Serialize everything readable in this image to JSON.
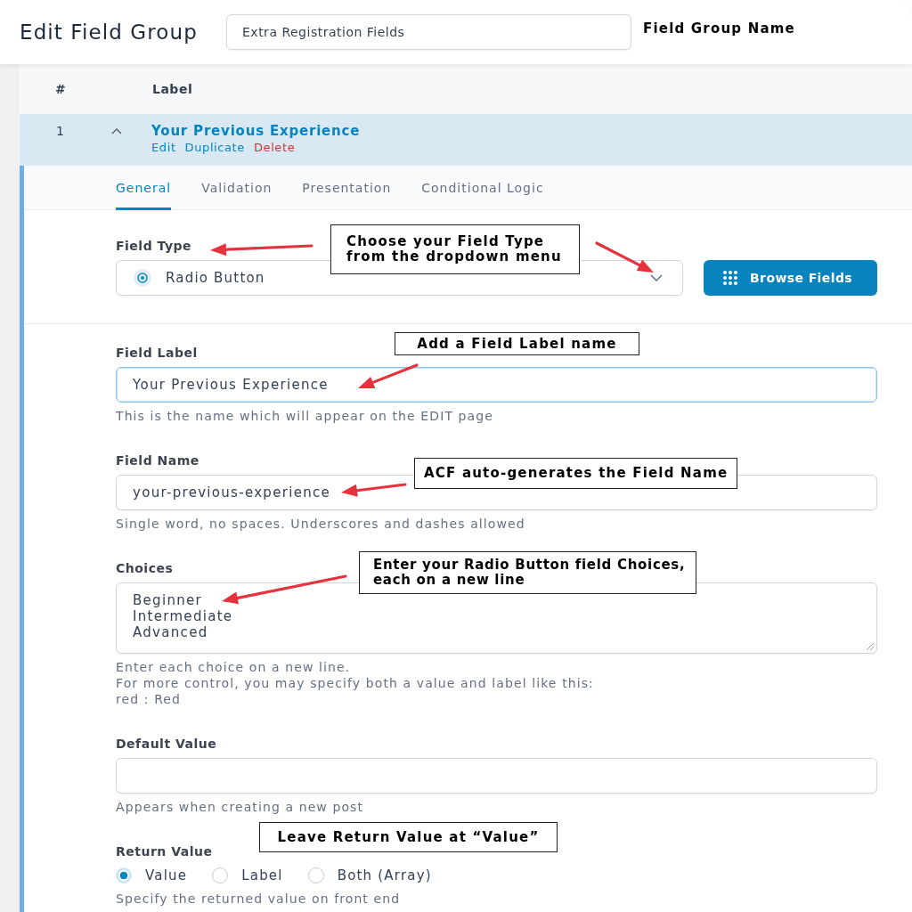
{
  "header": {
    "title": "Edit Field Group",
    "group_name": "Extra Registration Fields"
  },
  "table": {
    "columns": [
      "#",
      "Label"
    ],
    "rows": [
      {
        "number": "1",
        "label": "Your Previous Experience",
        "selected": true,
        "expanded": true,
        "actions": [
          {
            "label": "Edit",
            "kind": "link"
          },
          {
            "label": "Duplicate",
            "kind": "link"
          },
          {
            "label": "Delete",
            "kind": "danger"
          }
        ]
      }
    ]
  },
  "tabs": [
    {
      "label": "General",
      "selected": true
    },
    {
      "label": "Validation",
      "selected": false
    },
    {
      "label": "Presentation",
      "selected": false
    },
    {
      "label": "Conditional Logic",
      "selected": false
    }
  ],
  "field_type": {
    "label": "Field Type",
    "value": "Radio Button",
    "button": "Browse Fields"
  },
  "settings": [
    {
      "kind": "text",
      "label": "Field Label",
      "value": "Your Previous Experience",
      "focused": true,
      "help": [
        "This is the name which will appear on the EDIT page"
      ]
    },
    {
      "kind": "text",
      "label": "Field Name",
      "value": "your-previous-experience",
      "focused": false,
      "help": [
        "Single word, no spaces. Underscores and dashes allowed"
      ]
    },
    {
      "kind": "textarea",
      "label": "Choices",
      "lines": [
        "Beginner",
        "Intermediate",
        "Advanced"
      ],
      "help": [
        "Enter each choice on a new line.",
        "For more control, you may specify both a value and label like this:",
        "red : Red"
      ]
    },
    {
      "kind": "text",
      "label": "Default Value",
      "focused": false,
      "help": [
        "Appears when creating a new post"
      ]
    },
    {
      "kind": "radio",
      "label": "Return Value",
      "options": [
        {
          "label": "Value",
          "selected": true
        },
        {
          "label": "Label",
          "selected": false
        },
        {
          "label": "Both (Array)",
          "selected": false
        }
      ],
      "help": [
        "Specify the returned value on front end"
      ]
    }
  ],
  "annotations": [
    {
      "kind": "plain",
      "text": "Field Group Name"
    },
    {
      "kind": "boxed",
      "text": "Choose your Field Type from the dropdown menu"
    },
    {
      "kind": "boxed",
      "text": "Add a Field Label name"
    },
    {
      "kind": "boxed",
      "text": "ACF auto-generates the Field Name"
    },
    {
      "kind": "boxed",
      "text": "Enter your Radio Button field Choices, each on a new line"
    },
    {
      "kind": "boxed",
      "text": "Leave Return Value at “Value”"
    }
  ]
}
